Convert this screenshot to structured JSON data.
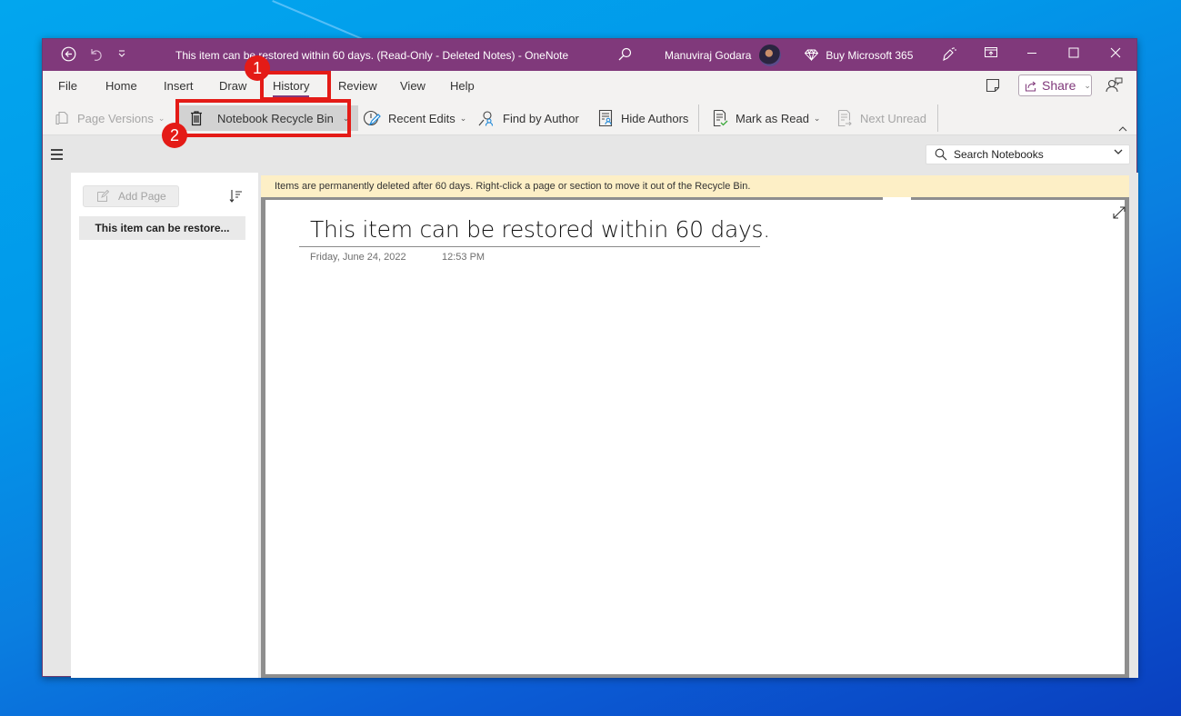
{
  "window": {
    "title": "This item can be restored within 60 days. (Read-Only - Deleted Notes)  -  OneNote",
    "user_name": "Manuviraj Godara",
    "buy_label": "Buy Microsoft 365",
    "accent_color": "#80397b"
  },
  "titlebar_icons": [
    "back-icon",
    "undo-icon",
    "quick-access-dropdown-icon",
    "search-icon",
    "avatar",
    "diamond-icon",
    "pen-sparkle-icon",
    "ribbon-display-icon",
    "minimize-icon",
    "maximize-icon",
    "close-icon"
  ],
  "tabs": [
    {
      "label": "File"
    },
    {
      "label": "Home"
    },
    {
      "label": "Insert"
    },
    {
      "label": "Draw"
    },
    {
      "label": "History",
      "active": true
    },
    {
      "label": "Review"
    },
    {
      "label": "View"
    },
    {
      "label": "Help"
    }
  ],
  "tabs_right": {
    "share_label": "Share"
  },
  "ribbon": {
    "page_versions": "Page Versions",
    "recycle_bin": "Notebook Recycle Bin",
    "recent_edits": "Recent Edits",
    "find_by_author": "Find by Author",
    "hide_authors": "Hide Authors",
    "mark_as_read": "Mark as Read",
    "next_unread": "Next Unread"
  },
  "annotations": {
    "step1": "1",
    "step2": "2",
    "highlight_color": "#e41b17"
  },
  "nav": {
    "search_placeholder": "Search Notebooks"
  },
  "pagelist": {
    "add_page": "Add Page",
    "pages": [
      {
        "title": "This item can be restore...",
        "selected": true
      }
    ]
  },
  "infobar": {
    "message": "Items are permanently deleted after 60 days. Right-click a page or section to move it out of the Recycle Bin."
  },
  "page": {
    "title": "This item can be restored within 60 days.",
    "date": "Friday, June 24, 2022",
    "time": "12:53 PM"
  }
}
